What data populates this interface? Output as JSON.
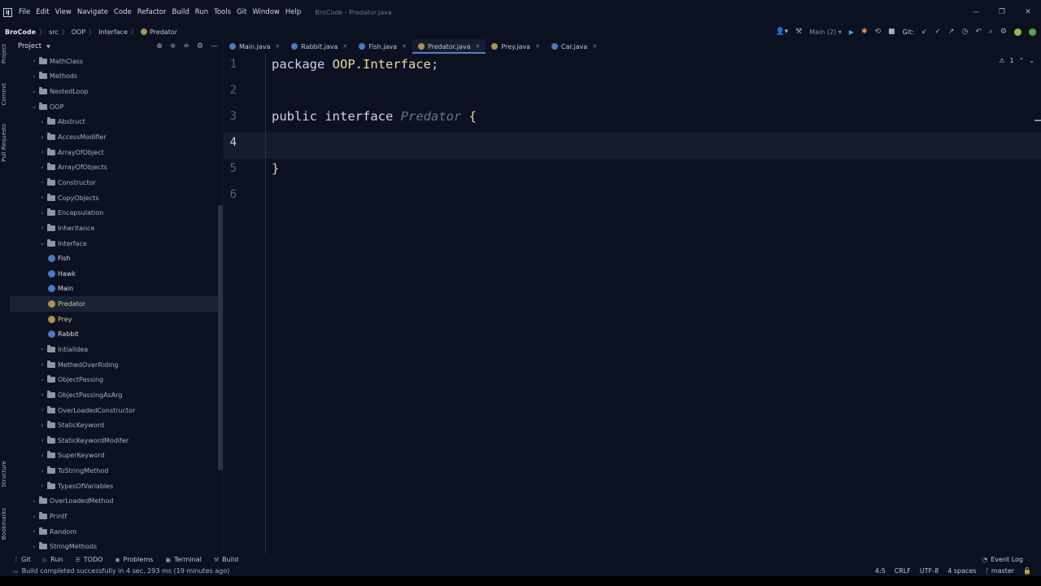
{
  "window": {
    "title": "BroCode - Predator.java",
    "logo": "IJ",
    "controls": [
      "—",
      "❐",
      "✕"
    ]
  },
  "menu": [
    "File",
    "Edit",
    "View",
    "Navigate",
    "Code",
    "Refactor",
    "Build",
    "Run",
    "Tools",
    "Git",
    "Window",
    "Help"
  ],
  "breadcrumbs": [
    "BroCode",
    "src",
    "OOP",
    "Interface",
    "Predator"
  ],
  "toolbar": {
    "run_config": "Main (2)",
    "git_label": "Git:"
  },
  "left_strip": [
    "Project",
    "Commit",
    "Pull Requests",
    "Structure",
    "Bookmarks"
  ],
  "project_panel": {
    "title": "Project"
  },
  "tree": [
    {
      "label": "MathClass",
      "kind": "folder",
      "level": 1,
      "expanded": false
    },
    {
      "label": "Methods",
      "kind": "folder",
      "level": 1,
      "expanded": false
    },
    {
      "label": "NestedLoop",
      "kind": "folder",
      "level": 1,
      "expanded": false
    },
    {
      "label": "OOP",
      "kind": "folder",
      "level": 1,
      "expanded": true
    },
    {
      "label": "Abstruct",
      "kind": "folder",
      "level": 2,
      "expanded": false
    },
    {
      "label": "AccessModifier",
      "kind": "folder",
      "level": 2,
      "expanded": false
    },
    {
      "label": "ArrayOfObject",
      "kind": "folder",
      "level": 2,
      "expanded": false
    },
    {
      "label": "ArrayOfObjects",
      "kind": "folder",
      "level": 2,
      "expanded": false
    },
    {
      "label": "Constructor",
      "kind": "folder",
      "level": 2,
      "expanded": false
    },
    {
      "label": "CopyObjects",
      "kind": "folder",
      "level": 2,
      "expanded": false
    },
    {
      "label": "Encapsulation",
      "kind": "folder",
      "level": 2,
      "expanded": false
    },
    {
      "label": "Inheritance",
      "kind": "folder",
      "level": 2,
      "expanded": false
    },
    {
      "label": "Interface",
      "kind": "folder",
      "level": 2,
      "expanded": true
    },
    {
      "label": "Fish",
      "kind": "class",
      "level": 3
    },
    {
      "label": "Hawk",
      "kind": "class",
      "level": 3
    },
    {
      "label": "Main",
      "kind": "class",
      "level": 3
    },
    {
      "label": "Predator",
      "kind": "interface",
      "level": 3,
      "selected": true
    },
    {
      "label": "Prey",
      "kind": "interface",
      "level": 3
    },
    {
      "label": "Rabbit",
      "kind": "class",
      "level": 3
    },
    {
      "label": "IntialIdea",
      "kind": "folder",
      "level": 2,
      "expanded": false
    },
    {
      "label": "MethedOverRiding",
      "kind": "folder",
      "level": 2,
      "expanded": false
    },
    {
      "label": "ObjectPassing",
      "kind": "folder",
      "level": 2,
      "expanded": false
    },
    {
      "label": "ObjectPassingAsArg",
      "kind": "folder",
      "level": 2,
      "expanded": false
    },
    {
      "label": "OverLoadedConstructor",
      "kind": "folder",
      "level": 2,
      "expanded": false
    },
    {
      "label": "StaticKeyword",
      "kind": "folder",
      "level": 2,
      "expanded": false
    },
    {
      "label": "StaticKeywordModifer",
      "kind": "folder",
      "level": 2,
      "expanded": false
    },
    {
      "label": "SuperKeyword",
      "kind": "folder",
      "level": 2,
      "expanded": false
    },
    {
      "label": "ToStringMethod",
      "kind": "folder",
      "level": 2,
      "expanded": false
    },
    {
      "label": "TypesOfVariables",
      "kind": "folder",
      "level": 2,
      "expanded": false
    },
    {
      "label": "OverLoadedMethod",
      "kind": "folder",
      "level": 1,
      "expanded": false
    },
    {
      "label": "Printf",
      "kind": "folder",
      "level": 1,
      "expanded": false
    },
    {
      "label": "Random",
      "kind": "folder",
      "level": 1,
      "expanded": false
    },
    {
      "label": "StringMethods",
      "kind": "folder",
      "level": 1,
      "expanded": false
    }
  ],
  "tabs": [
    {
      "label": "Main.java",
      "kind": "class",
      "active": false
    },
    {
      "label": "Rabbit.java",
      "kind": "class",
      "active": false
    },
    {
      "label": "Fish.java",
      "kind": "class",
      "active": false
    },
    {
      "label": "Predator.java",
      "kind": "interface",
      "active": true
    },
    {
      "label": "Prey.java",
      "kind": "interface",
      "active": false
    },
    {
      "label": "Car.java",
      "kind": "class",
      "active": false
    }
  ],
  "editor": {
    "current_line": 4,
    "warnings": "1",
    "lines": [
      {
        "num": "1",
        "tokens": [
          {
            "t": "package ",
            "c": "kw"
          },
          {
            "t": "OOP.Interface",
            "c": "pkg"
          },
          {
            "t": ";",
            "c": "punc"
          }
        ]
      },
      {
        "num": "2",
        "tokens": []
      },
      {
        "num": "3",
        "tokens": [
          {
            "t": "public ",
            "c": "kw"
          },
          {
            "t": "interface ",
            "c": "kw"
          },
          {
            "t": "Predator",
            "c": "iname"
          },
          {
            "t": " {",
            "c": "brace"
          }
        ]
      },
      {
        "num": "4",
        "tokens": []
      },
      {
        "num": "5",
        "tokens": [
          {
            "t": "}",
            "c": "brace"
          }
        ]
      },
      {
        "num": "6",
        "tokens": []
      }
    ]
  },
  "bottom_tools": [
    {
      "label": "Git",
      "icon": "branch-icon"
    },
    {
      "label": "Run",
      "icon": "run-icon"
    },
    {
      "label": "TODO",
      "icon": "list-icon"
    },
    {
      "label": "Problems",
      "icon": "problems-icon"
    },
    {
      "label": "Terminal",
      "icon": "terminal-icon"
    },
    {
      "label": "Build",
      "icon": "hammer-icon"
    }
  ],
  "event_log": "Event Log",
  "status": {
    "message": "Build completed successfully in 4 sec, 293 ms (19 minutes ago)",
    "position": "4:5",
    "line_sep": "CRLF",
    "encoding": "UTF-8",
    "indent": "4 spaces",
    "branch": "master"
  }
}
